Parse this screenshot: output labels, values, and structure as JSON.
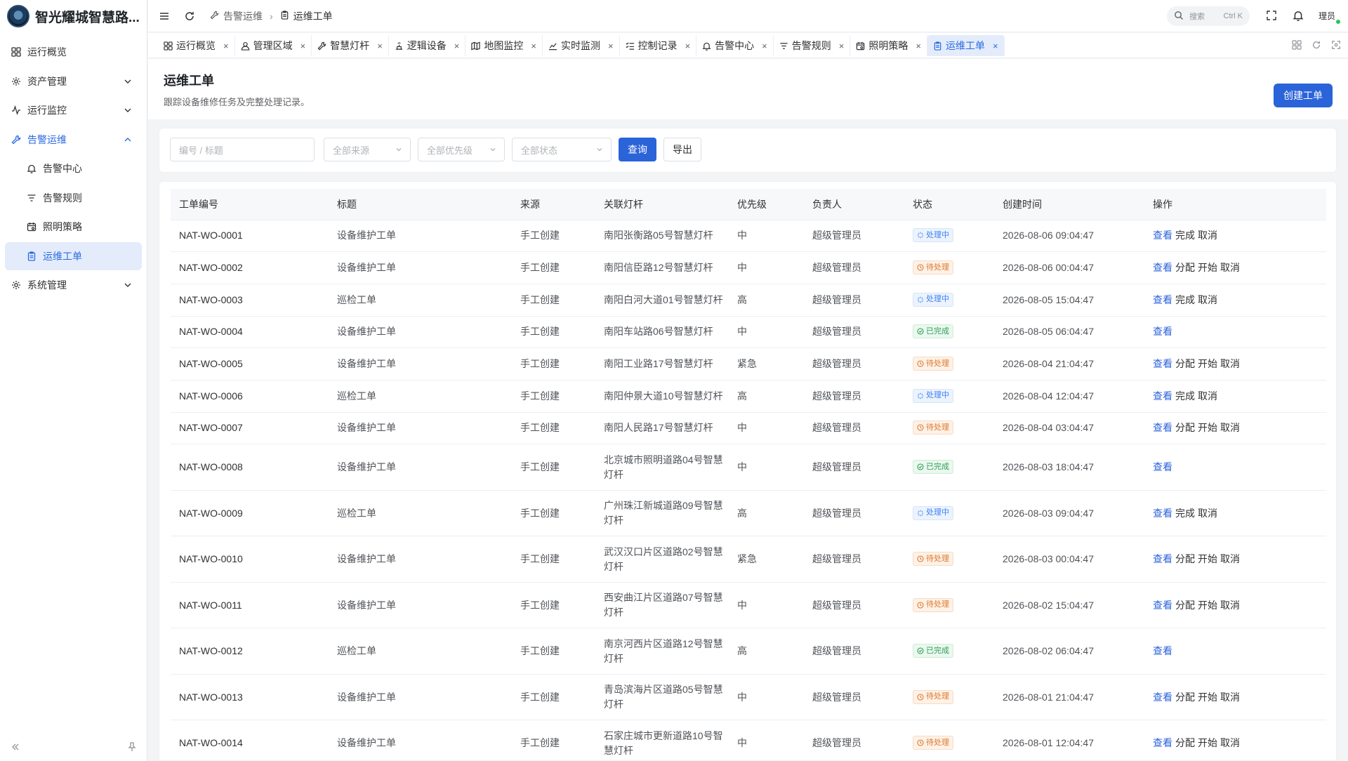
{
  "brand": {
    "title": "智光耀城智慧路..."
  },
  "sidebar": {
    "items": [
      {
        "label": "运行概览"
      },
      {
        "label": "资产管理"
      },
      {
        "label": "运行监控"
      },
      {
        "label": "告警运维"
      },
      {
        "label": "告警中心"
      },
      {
        "label": "告警规则"
      },
      {
        "label": "照明策略"
      },
      {
        "label": "运维工单"
      },
      {
        "label": "系统管理"
      }
    ]
  },
  "header": {
    "breadcrumb": [
      "告警运维",
      "运维工单"
    ],
    "search_placeholder": "搜索",
    "search_shortcut": "Ctrl K",
    "user": "理员"
  },
  "tabs": [
    {
      "label": "运行概览",
      "icon": "grid-icon"
    },
    {
      "label": "管理区域",
      "icon": "user-icon"
    },
    {
      "label": "智慧灯杆",
      "icon": "wrench-icon"
    },
    {
      "label": "逻辑设备",
      "icon": "device-icon"
    },
    {
      "label": "地图监控",
      "icon": "map-icon"
    },
    {
      "label": "实时监测",
      "icon": "chart-icon"
    },
    {
      "label": "控制记录",
      "icon": "list-check-icon"
    },
    {
      "label": "告警中心",
      "icon": "bell-icon"
    },
    {
      "label": "告警规则",
      "icon": "filter-icon"
    },
    {
      "label": "照明策略",
      "icon": "calendar-icon"
    },
    {
      "label": "运维工单",
      "icon": "clipboard-icon"
    }
  ],
  "page": {
    "title": "运维工单",
    "description": "跟踪设备维修任务及完整处理记录。",
    "create_button": "创建工单"
  },
  "filters": {
    "keyword_placeholder": "编号 / 标题",
    "source_placeholder": "全部来源",
    "priority_placeholder": "全部优先级",
    "status_placeholder": "全部状态",
    "query_button": "查询",
    "export_button": "导出"
  },
  "table": {
    "headers": [
      "工单编号",
      "标题",
      "来源",
      "关联灯杆",
      "优先级",
      "负责人",
      "状态",
      "创建时间",
      "操作"
    ],
    "rows": [
      {
        "id": "NAT-WO-0001",
        "title": "设备维护工单",
        "source": "手工创建",
        "pole": "南阳张衡路05号智慧灯杆",
        "priority": "中",
        "owner": "超级管理员",
        "status": "处理中",
        "status_type": "processing",
        "created": "2026-08-06 09:04:47",
        "actions": [
          "查看",
          "完成",
          "取消"
        ]
      },
      {
        "id": "NAT-WO-0002",
        "title": "设备维护工单",
        "source": "手工创建",
        "pole": "南阳信臣路12号智慧灯杆",
        "priority": "中",
        "owner": "超级管理员",
        "status": "待处理",
        "status_type": "pending",
        "created": "2026-08-06 00:04:47",
        "actions": [
          "查看",
          "分配",
          "开始",
          "取消"
        ]
      },
      {
        "id": "NAT-WO-0003",
        "title": "巡检工单",
        "source": "手工创建",
        "pole": "南阳白河大道01号智慧灯杆",
        "priority": "高",
        "owner": "超级管理员",
        "status": "处理中",
        "status_type": "processing",
        "created": "2026-08-05 15:04:47",
        "actions": [
          "查看",
          "完成",
          "取消"
        ]
      },
      {
        "id": "NAT-WO-0004",
        "title": "设备维护工单",
        "source": "手工创建",
        "pole": "南阳车站路06号智慧灯杆",
        "priority": "中",
        "owner": "超级管理员",
        "status": "已完成",
        "status_type": "done",
        "created": "2026-08-05 06:04:47",
        "actions": [
          "查看"
        ]
      },
      {
        "id": "NAT-WO-0005",
        "title": "设备维护工单",
        "source": "手工创建",
        "pole": "南阳工业路17号智慧灯杆",
        "priority": "紧急",
        "owner": "超级管理员",
        "status": "待处理",
        "status_type": "pending",
        "created": "2026-08-04 21:04:47",
        "actions": [
          "查看",
          "分配",
          "开始",
          "取消"
        ]
      },
      {
        "id": "NAT-WO-0006",
        "title": "巡检工单",
        "source": "手工创建",
        "pole": "南阳仲景大道10号智慧灯杆",
        "priority": "高",
        "owner": "超级管理员",
        "status": "处理中",
        "status_type": "processing",
        "created": "2026-08-04 12:04:47",
        "actions": [
          "查看",
          "完成",
          "取消"
        ]
      },
      {
        "id": "NAT-WO-0007",
        "title": "设备维护工单",
        "source": "手工创建",
        "pole": "南阳人民路17号智慧灯杆",
        "priority": "中",
        "owner": "超级管理员",
        "status": "待处理",
        "status_type": "pending",
        "created": "2026-08-04 03:04:47",
        "actions": [
          "查看",
          "分配",
          "开始",
          "取消"
        ]
      },
      {
        "id": "NAT-WO-0008",
        "title": "设备维护工单",
        "source": "手工创建",
        "pole": "北京城市照明道路04号智慧灯杆",
        "priority": "中",
        "owner": "超级管理员",
        "status": "已完成",
        "status_type": "done",
        "created": "2026-08-03 18:04:47",
        "actions": [
          "查看"
        ]
      },
      {
        "id": "NAT-WO-0009",
        "title": "巡检工单",
        "source": "手工创建",
        "pole": "广州珠江新城道路09号智慧灯杆",
        "priority": "高",
        "owner": "超级管理员",
        "status": "处理中",
        "status_type": "processing",
        "created": "2026-08-03 09:04:47",
        "actions": [
          "查看",
          "完成",
          "取消"
        ]
      },
      {
        "id": "NAT-WO-0010",
        "title": "设备维护工单",
        "source": "手工创建",
        "pole": "武汉汉口片区道路02号智慧灯杆",
        "priority": "紧急",
        "owner": "超级管理员",
        "status": "待处理",
        "status_type": "pending",
        "created": "2026-08-03 00:04:47",
        "actions": [
          "查看",
          "分配",
          "开始",
          "取消"
        ]
      },
      {
        "id": "NAT-WO-0011",
        "title": "设备维护工单",
        "source": "手工创建",
        "pole": "西安曲江片区道路07号智慧灯杆",
        "priority": "中",
        "owner": "超级管理员",
        "status": "待处理",
        "status_type": "pending",
        "created": "2026-08-02 15:04:47",
        "actions": [
          "查看",
          "分配",
          "开始",
          "取消"
        ]
      },
      {
        "id": "NAT-WO-0012",
        "title": "巡检工单",
        "source": "手工创建",
        "pole": "南京河西片区道路12号智慧灯杆",
        "priority": "高",
        "owner": "超级管理员",
        "status": "已完成",
        "status_type": "done",
        "created": "2026-08-02 06:04:47",
        "actions": [
          "查看"
        ]
      },
      {
        "id": "NAT-WO-0013",
        "title": "设备维护工单",
        "source": "手工创建",
        "pole": "青岛滨海片区道路05号智慧灯杆",
        "priority": "中",
        "owner": "超级管理员",
        "status": "待处理",
        "status_type": "pending",
        "created": "2026-08-01 21:04:47",
        "actions": [
          "查看",
          "分配",
          "开始",
          "取消"
        ]
      },
      {
        "id": "NAT-WO-0014",
        "title": "设备维护工单",
        "source": "手工创建",
        "pole": "石家庄城市更新道路10号智慧灯杆",
        "priority": "中",
        "owner": "超级管理员",
        "status": "待处理",
        "status_type": "pending",
        "created": "2026-08-01 12:04:47",
        "actions": [
          "查看",
          "分配",
          "开始",
          "取消"
        ]
      }
    ]
  },
  "colors": {
    "accent": "#2b63d9",
    "processing": "#3b82f6",
    "pending": "#e0782b",
    "done": "#2e9e55"
  }
}
